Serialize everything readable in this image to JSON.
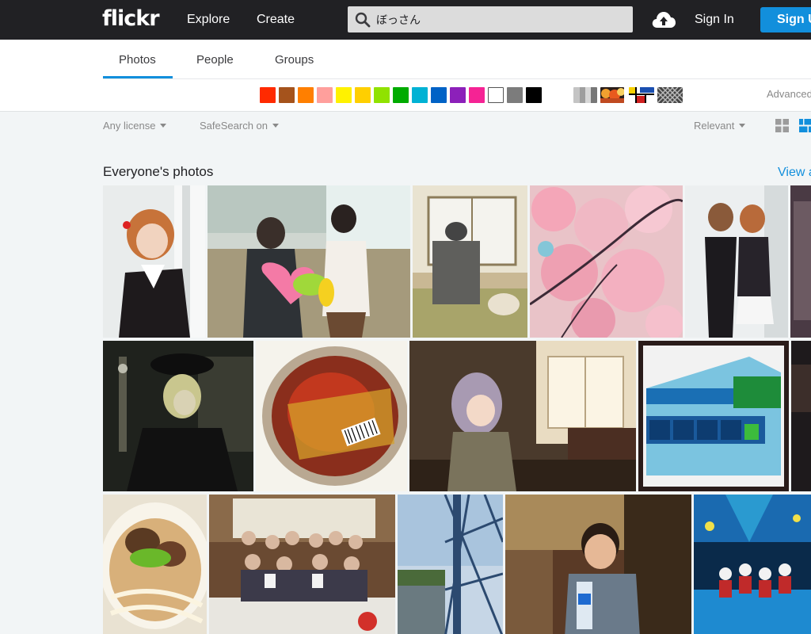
{
  "header": {
    "logo": "flickr",
    "nav": [
      "Explore",
      "Create"
    ],
    "search_value": "ぼっさん",
    "sign_in": "Sign In",
    "sign_up": "Sign Up"
  },
  "tabs": [
    "Photos",
    "People",
    "Groups"
  ],
  "active_tab": "Photos",
  "colors": [
    "#ff2a00",
    "#a5531c",
    "#ff7f00",
    "#ff9f9c",
    "#fff200",
    "#ffcf00",
    "#90e200",
    "#00ab00",
    "#00b2d4",
    "#0062c6",
    "#8c20ba",
    "#f52394",
    "#ffffff",
    "#7c7c7c",
    "#000000"
  ],
  "advanced_label": "Advanced",
  "filters": {
    "license": "Any license",
    "safesearch": "SafeSearch on",
    "sort": "Relevant"
  },
  "section": {
    "title": "Everyone's photos",
    "view_all": "View all"
  },
  "photos": [
    "cosplay-girl-orange-hair",
    "family-with-balloon",
    "room-with-heater",
    "cherry-blossoms",
    "cosplay-couple",
    "building-partial",
    "gothic-doll",
    "cup-noodle-taiwan-ramen",
    "doll-indoor",
    "memory-package",
    "dark-partial",
    "udon-noodles",
    "group-photo-party",
    "steel-bridge",
    "boy-with-bottle",
    "blue-stage-performance"
  ]
}
